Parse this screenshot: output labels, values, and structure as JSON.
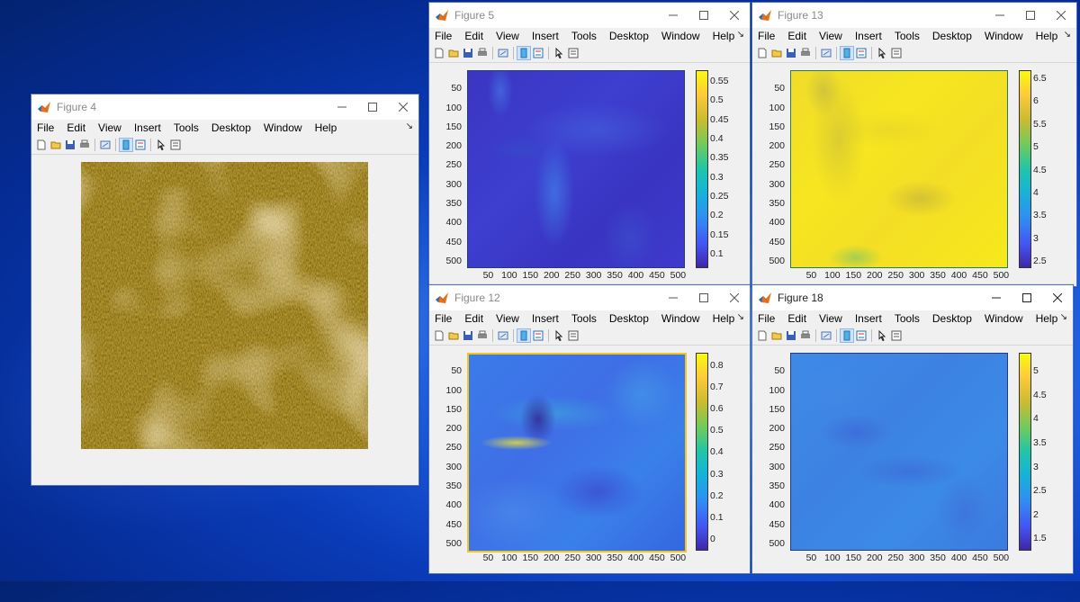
{
  "colors": {
    "desktop_blue": "#0a3bb8",
    "window_border": "#4d73c7",
    "parula_low": "#3e26a8",
    "parula_high": "#f9fb0e",
    "gold": "#d4a017"
  },
  "menu": [
    "File",
    "Edit",
    "View",
    "Insert",
    "Tools",
    "Desktop",
    "Window",
    "Help"
  ],
  "toolbar_icons": [
    "new-figure-icon",
    "open-file-icon",
    "save-icon",
    "print-icon",
    "link-plot-icon",
    "colorbar-icon",
    "legend-icon",
    "pointer-icon",
    "property-inspector-icon"
  ],
  "figures": {
    "fig4": {
      "title": "Figure 4"
    },
    "fig5": {
      "title": "Figure 5",
      "y_ticks": [
        "50",
        "100",
        "150",
        "200",
        "250",
        "300",
        "350",
        "400",
        "450",
        "500"
      ],
      "x_ticks": [
        "50",
        "100",
        "150",
        "200",
        "250",
        "300",
        "350",
        "400",
        "450",
        "500"
      ],
      "cbar_ticks": [
        "0.55",
        "0.5",
        "0.45",
        "0.4",
        "0.35",
        "0.3",
        "0.25",
        "0.2",
        "0.15",
        "0.1"
      ]
    },
    "fig13": {
      "title": "Figure 13",
      "y_ticks": [
        "50",
        "100",
        "150",
        "200",
        "250",
        "300",
        "350",
        "400",
        "450",
        "500"
      ],
      "x_ticks": [
        "50",
        "100",
        "150",
        "200",
        "250",
        "300",
        "350",
        "400",
        "450",
        "500"
      ],
      "cbar_ticks": [
        "6.5",
        "6",
        "5.5",
        "5",
        "4.5",
        "4",
        "3.5",
        "3",
        "2.5"
      ]
    },
    "fig12": {
      "title": "Figure 12",
      "y_ticks": [
        "50",
        "100",
        "150",
        "200",
        "250",
        "300",
        "350",
        "400",
        "450",
        "500"
      ],
      "x_ticks": [
        "50",
        "100",
        "150",
        "200",
        "250",
        "300",
        "350",
        "400",
        "450",
        "500"
      ],
      "cbar_ticks": [
        "0.8",
        "0.7",
        "0.6",
        "0.5",
        "0.4",
        "0.3",
        "0.2",
        "0.1",
        "0"
      ]
    },
    "fig18": {
      "title": "Figure 18",
      "y_ticks": [
        "50",
        "100",
        "150",
        "200",
        "250",
        "300",
        "350",
        "400",
        "450",
        "500"
      ],
      "x_ticks": [
        "50",
        "100",
        "150",
        "200",
        "250",
        "300",
        "350",
        "400",
        "450",
        "500"
      ],
      "cbar_ticks": [
        "5",
        "4.5",
        "4",
        "3.5",
        "3",
        "2.5",
        "2",
        "1.5"
      ]
    }
  }
}
